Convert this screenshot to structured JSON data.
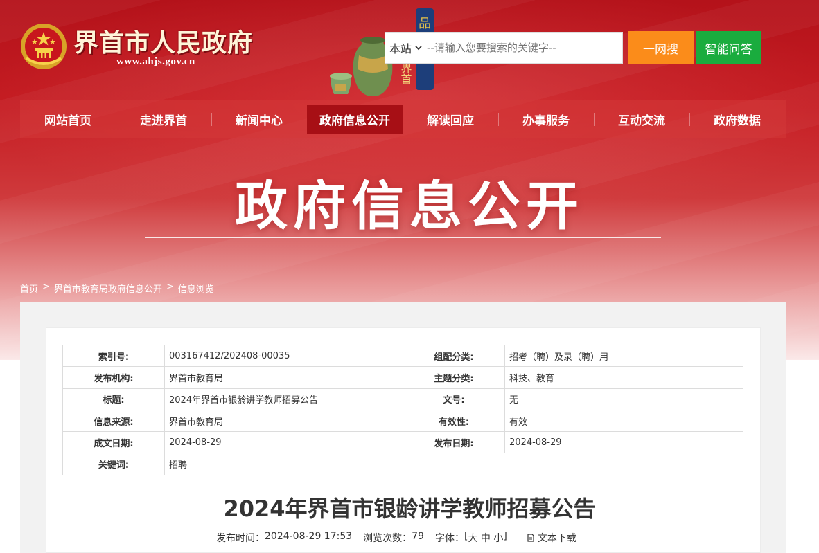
{
  "header": {
    "site_title": "界首市人民政府",
    "site_url": "www.ahjs.gov.cn",
    "banner_side_text_1": "品",
    "banner_side_text_2": "界首"
  },
  "search": {
    "scope_label": "本站",
    "placeholder": "--请输入您要搜索的关键字--",
    "search_button": "一网搜",
    "qa_button": "智能问答"
  },
  "nav": {
    "items": [
      "网站首页",
      "走进界首",
      "新闻中心",
      "政府信息公开",
      "解读回应",
      "办事服务",
      "互动交流",
      "政府数据"
    ],
    "active_index": 3
  },
  "banner": {
    "title": "政府信息公开"
  },
  "breadcrumb": {
    "home": "首页",
    "sep": ">",
    "level1": "界首市教育局政府信息公开",
    "level2": "信息浏览"
  },
  "meta_table": {
    "index_label": "索引号:",
    "index_value": "003167412/202408-00035",
    "category_label": "组配分类:",
    "category_value": "招考（聘）及录（聘）用",
    "publisher_label": "发布机构:",
    "publisher_value": "界首市教育局",
    "topic_label": "主题分类:",
    "topic_value": "科技、教育",
    "title_label": "标题:",
    "title_value": "2024年界首市银龄讲学教师招募公告",
    "docno_label": "文号:",
    "docno_value": "无",
    "source_label": "信息来源:",
    "source_value": "界首市教育局",
    "validity_label": "有效性:",
    "validity_value": "有效",
    "created_label": "成文日期:",
    "created_value": "2024-08-29",
    "published_label": "发布日期:",
    "published_value": "2024-08-29",
    "keywords_label": "关键词:",
    "keywords_value": "招聘"
  },
  "article": {
    "title": "2024年界首市银龄讲学教师招募公告",
    "publish_time_label": "发布时间：",
    "publish_time": "2024-08-29 17:53",
    "views_label": "浏览次数：",
    "views": "79",
    "font_label": "字体：",
    "font_open": "[",
    "font_large": "大",
    "font_medium": "中",
    "font_small": "小",
    "font_close": "]",
    "download_label": "文本下载"
  },
  "colors": {
    "primary_red": "#b4121a",
    "nav_active": "#a70f15",
    "search_orange": "#fb8c1a",
    "qa_green": "#1aac3e"
  }
}
